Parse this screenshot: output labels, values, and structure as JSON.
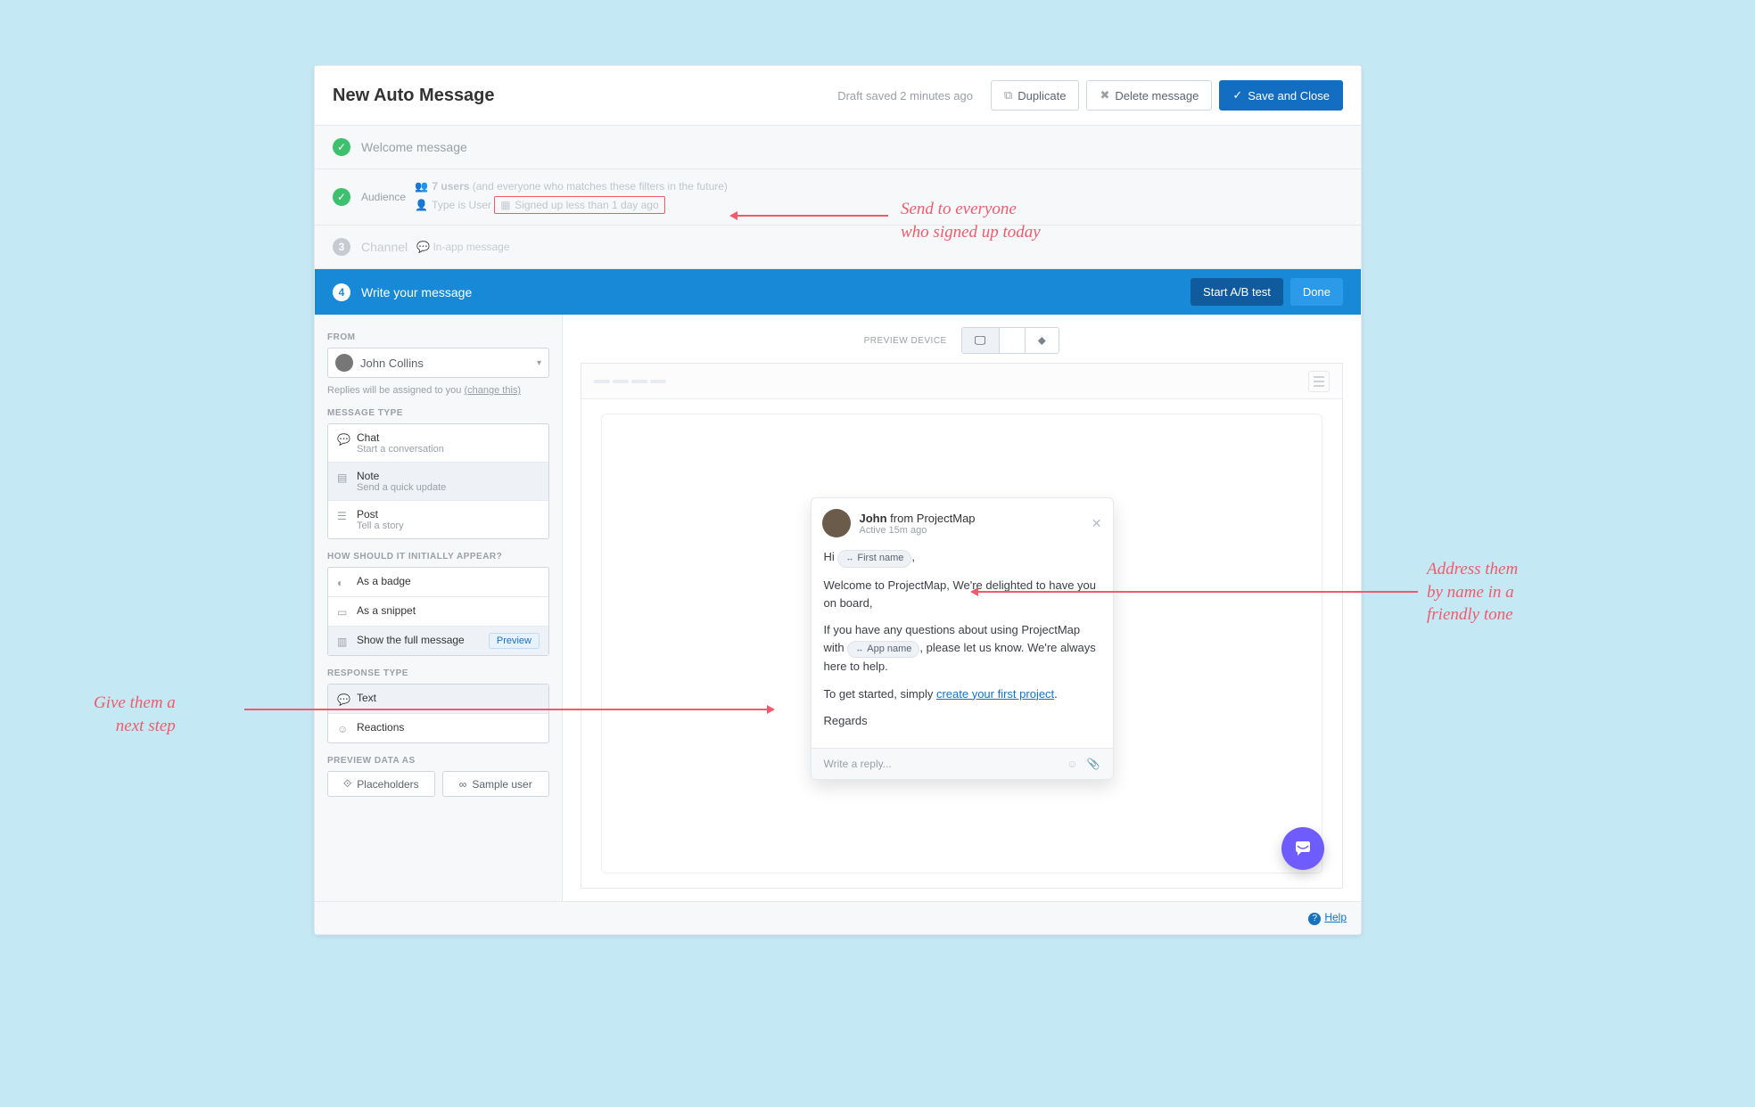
{
  "header": {
    "title": "New Auto Message",
    "draft_text": "Draft saved 2 minutes ago",
    "duplicate_label": "Duplicate",
    "delete_label": "Delete message",
    "save_label": "Save and Close"
  },
  "steps": {
    "welcome_label": "Welcome message",
    "audience_label": "Audience",
    "audience_line1_prefix": "7 users",
    "audience_line1_suffix": " (and everyone who matches these filters in the future)",
    "audience_line2_prefix": "Type is User",
    "audience_line2_highlight": "Signed up less than 1 day ago",
    "channel_label": "Channel",
    "channel_value": "In-app message",
    "write_label": "Write your message",
    "ab_label": "Start A/B test",
    "done_label": "Done"
  },
  "left": {
    "from_label": "FROM",
    "from_name": "John Collins",
    "replies_text": "Replies will be assigned to you ",
    "replies_link": "(change this)",
    "msg_type_label": "MESSAGE TYPE",
    "msg_types": [
      {
        "title": "Chat",
        "sub": "Start a conversation"
      },
      {
        "title": "Note",
        "sub": "Send a quick update"
      },
      {
        "title": "Post",
        "sub": "Tell a story"
      }
    ],
    "appear_label": "HOW SHOULD IT INITIALLY APPEAR?",
    "appear_options": [
      "As a badge",
      "As a snippet",
      "Show the full message"
    ],
    "preview_chip": "Preview",
    "response_label": "RESPONSE TYPE",
    "response_options": [
      "Text",
      "Reactions"
    ],
    "data_label": "PREVIEW DATA AS",
    "data_options": [
      "Placeholders",
      "Sample user"
    ]
  },
  "preview": {
    "device_label": "PREVIEW DEVICE",
    "sender_name": "John",
    "sender_from": " from ProjectMap",
    "active_text": "Active 15m ago",
    "greeting_prefix": "Hi ",
    "greeting_suffix": ",",
    "token_first_name": "First name",
    "p1": "Welcome to ProjectMap, We're delighted to have you on board,",
    "p2_prefix": "If you have any questions about using ProjectMap with ",
    "token_app_name": "App name",
    "p2_suffix": ", please let us know. We're always here to help.",
    "p3_prefix": "To get started, simply ",
    "p3_link": "create your first project",
    "p3_suffix": ".",
    "regards": "Regards",
    "reply_placeholder": "Write a reply..."
  },
  "help_label": "Help",
  "annotations": {
    "a1": "Send to everyone\nwho signed up today",
    "a2": "Address them\nby name in a\nfriendly tone",
    "a3": "Give them a\nnext step"
  }
}
